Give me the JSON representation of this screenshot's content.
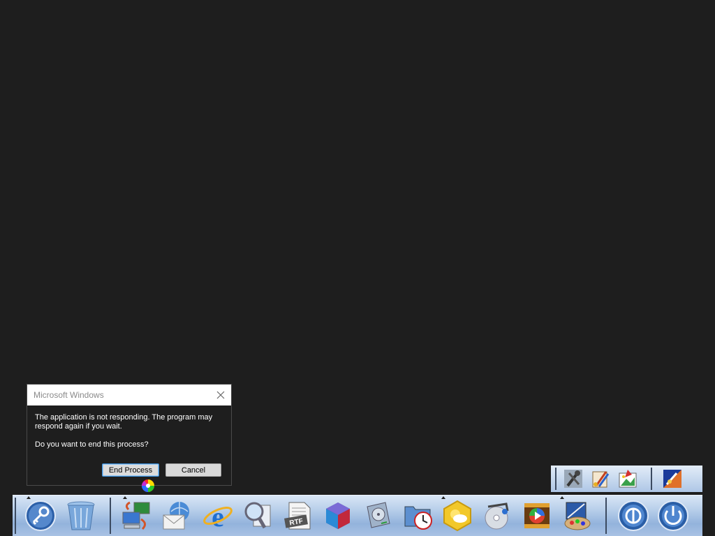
{
  "dialog": {
    "title": "Microsoft Windows",
    "message": "The application is not responding. The program may respond again if you wait.",
    "question": "Do you want to end this process?",
    "end_button": "End Process",
    "cancel_button": "Cancel"
  },
  "dock": {
    "items": [
      {
        "icon": "key-icon"
      },
      {
        "icon": "recycle-bin-icon"
      },
      {
        "icon": "network-computers-icon"
      },
      {
        "icon": "globe-mail-icon"
      },
      {
        "icon": "internet-explorer-icon"
      },
      {
        "icon": "magnifier-icon"
      },
      {
        "icon": "rtf-document-icon"
      },
      {
        "icon": "3d-cube-icon"
      },
      {
        "icon": "hard-drive-icon"
      },
      {
        "icon": "folder-clock-icon"
      },
      {
        "icon": "weather-icon"
      },
      {
        "icon": "media-disc-icon"
      },
      {
        "icon": "video-player-icon"
      },
      {
        "icon": "paint-palette-icon"
      },
      {
        "icon": "logoff-icon"
      },
      {
        "icon": "power-icon"
      }
    ]
  },
  "tray": {
    "items": [
      {
        "icon": "tools-icon"
      },
      {
        "icon": "paint-brushes-icon"
      },
      {
        "icon": "picture-editor-icon"
      },
      {
        "icon": "art-app-icon"
      }
    ]
  },
  "colors": {
    "background": "#1e1e1e",
    "dock_gradient_top": "#d9e6f6",
    "dock_gradient_bottom": "#93b3dc",
    "focus_blue": "#3c8fd8"
  }
}
